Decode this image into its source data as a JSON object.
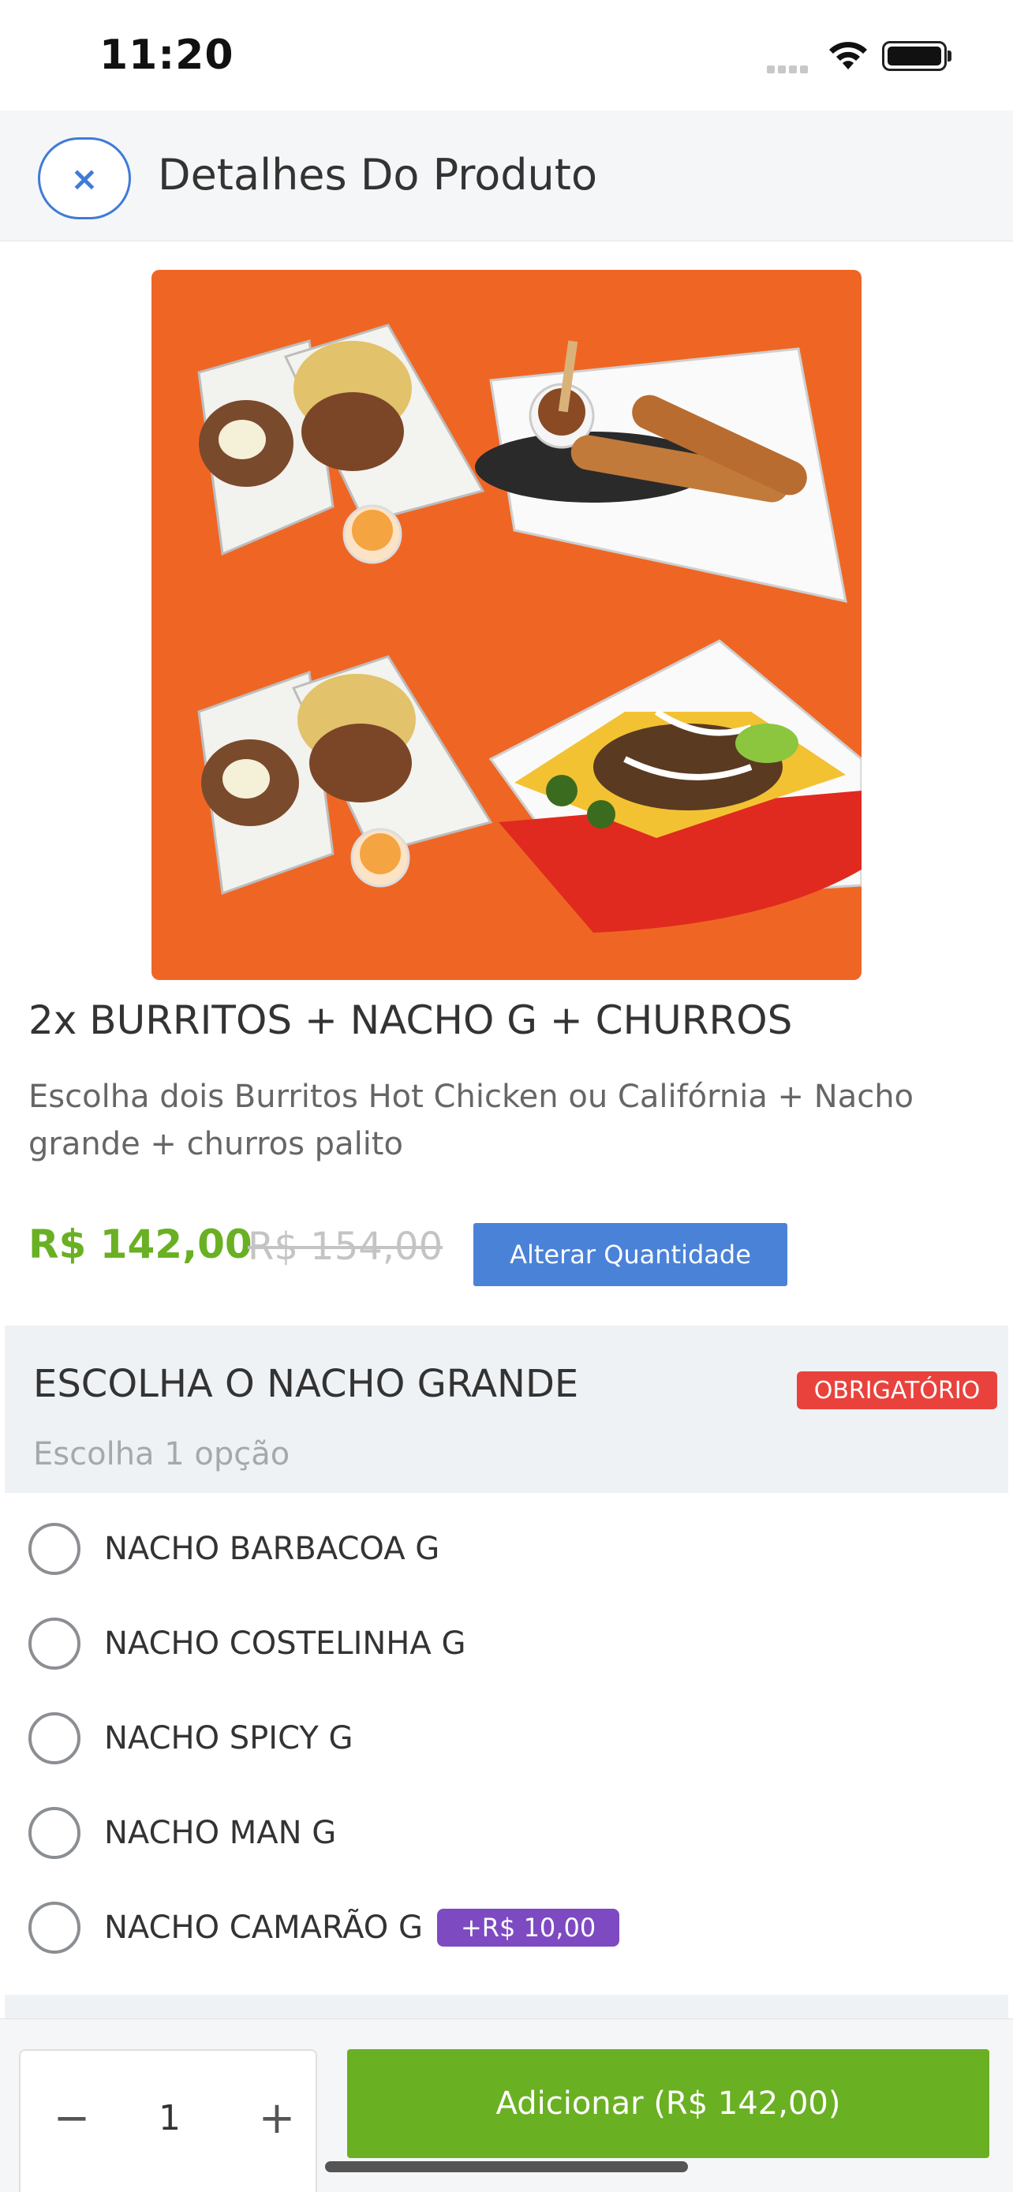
{
  "status_bar": {
    "time": "11:20"
  },
  "header": {
    "title": "Detalhes Do Produto",
    "close_glyph": "×"
  },
  "product": {
    "name": "2x BURRITOS + NACHO G + CHURROS",
    "description": "Escolha dois Burritos Hot Chicken ou Califórnia + Nacho grande + churros palito",
    "price": "R$ 142,00",
    "old_price": "R$ 154,00",
    "change_quantity_label": "Alterar Quantidade"
  },
  "option_group": {
    "title": "ESCOLHA O NACHO GRANDE",
    "required_badge": "OBRIGATÓRIO",
    "subtitle": "Escolha 1 opção",
    "options": [
      {
        "label": "NACHO BARBACOA G"
      },
      {
        "label": "NACHO COSTELINHA G"
      },
      {
        "label": "NACHO SPICY G"
      },
      {
        "label": "NACHO MAN G"
      },
      {
        "label": "NACHO CAMARÃO G",
        "extra": "+R$ 10,00"
      }
    ]
  },
  "bottom_bar": {
    "minus": "−",
    "quantity": "1",
    "plus": "+",
    "add_button": "Adicionar (R$ 142,00)"
  },
  "colors": {
    "accent_blue": "#3f7bd8",
    "price_green": "#6ab023",
    "required_red": "#e9423d",
    "extra_purple": "#7d4ac2",
    "image_background": "#ef6624"
  },
  "icons": [
    "close-icon",
    "wifi-icon",
    "battery-icon",
    "signal-icon"
  ]
}
